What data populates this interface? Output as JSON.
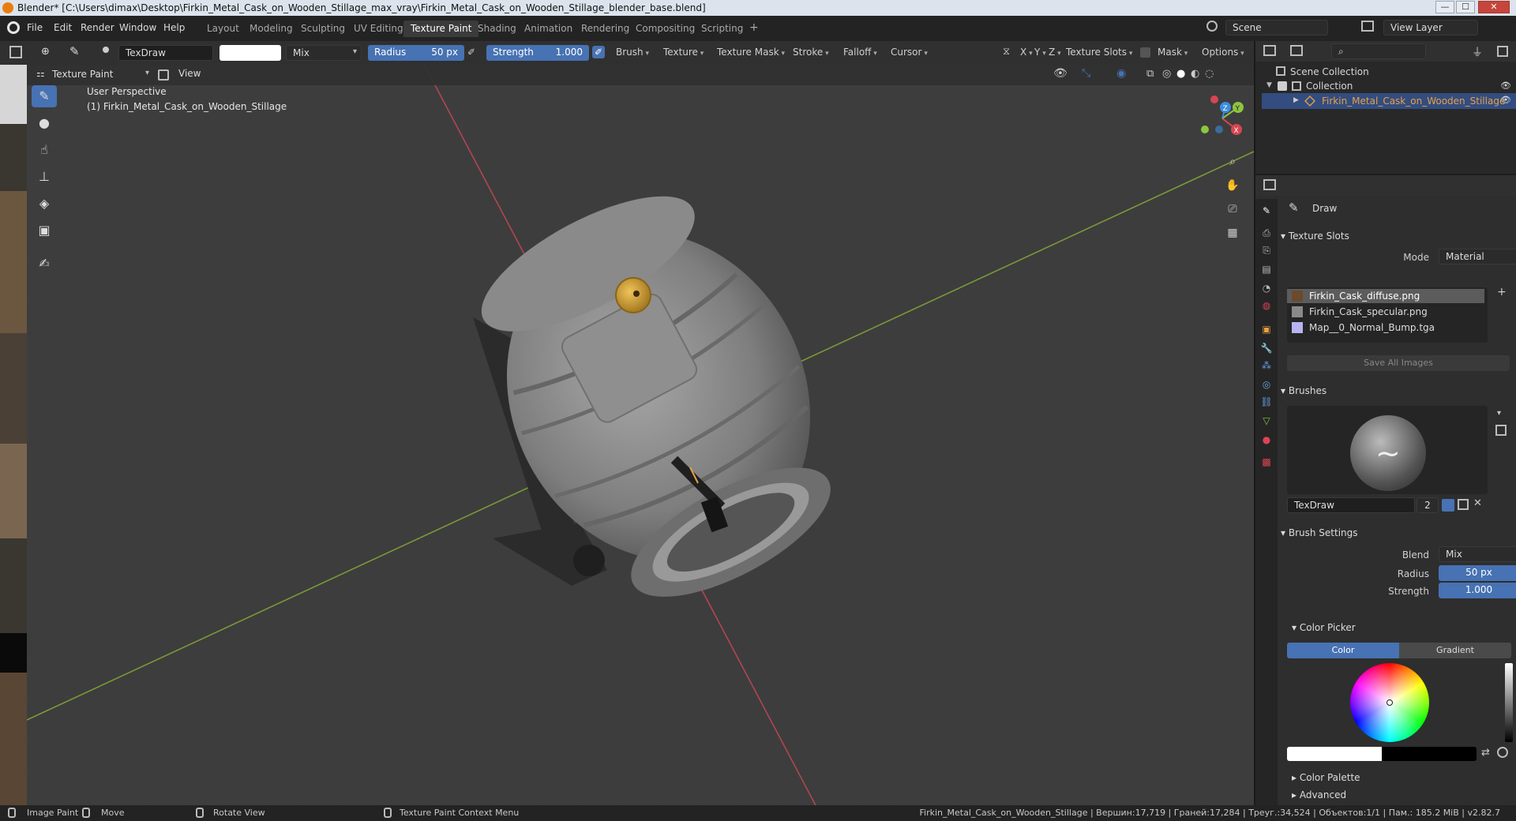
{
  "window": {
    "title": "Blender* [C:\\Users\\dimax\\Desktop\\Firkin_Metal_Cask_on_Wooden_Stillage_max_vray\\Firkin_Metal_Cask_on_Wooden_Stillage_blender_base.blend]",
    "minimize": "—",
    "maximize": "☐",
    "close": "✕"
  },
  "menu": [
    "File",
    "Edit",
    "Render",
    "Window",
    "Help"
  ],
  "workspaces": [
    "Layout",
    "Modeling",
    "Sculpting",
    "UV Editing",
    "Texture Paint",
    "Shading",
    "Animation",
    "Rendering",
    "Compositing",
    "Scripting"
  ],
  "active_workspace": "Texture Paint",
  "add_workspace": "+",
  "scene": {
    "name": "Scene",
    "view_layer": "View Layer"
  },
  "toolbar": {
    "brush_name": "TexDraw",
    "blend": "Mix",
    "radius_label": "Radius",
    "radius_value": "50 px",
    "strength_label": "Strength",
    "strength_value": "1.000",
    "menus": [
      "Brush",
      "Texture",
      "Texture Mask",
      "Stroke",
      "Falloff",
      "Cursor"
    ],
    "axes": [
      "X",
      "Y",
      "Z"
    ],
    "texture_slots": "Texture Slots",
    "mask": "Mask",
    "options": "Options",
    "color_swatch": "#ffffff"
  },
  "viewport": {
    "mode": "Texture Paint",
    "view_menu": "View",
    "perspective": "User Perspective",
    "object_label": "(1) Firkin_Metal_Cask_on_Wooden_Stillage",
    "gizmo": {
      "x": "X",
      "y": "Y",
      "z": "Z"
    }
  },
  "outliner": {
    "scene_collection": "Scene Collection",
    "collection": "Collection",
    "object": "Firkin_Metal_Cask_on_Wooden_Stillage"
  },
  "properties": {
    "tool_name": "Draw",
    "texture_slots": {
      "title": "Texture Slots",
      "mode_label": "Mode",
      "mode_value": "Material",
      "slots": [
        {
          "name": "Firkin_Cask_diffuse.png",
          "color": "#6b4a2e"
        },
        {
          "name": "Firkin_Cask_specular.png",
          "color": "#8a8a8a"
        },
        {
          "name": "Map__0_Normal_Bump.tga",
          "color": "#b8b4f0"
        }
      ],
      "save_all": "Save All Images"
    },
    "brushes": {
      "title": "Brushes",
      "name": "TexDraw",
      "users": "2"
    },
    "brush_settings": {
      "title": "Brush Settings",
      "blend_label": "Blend",
      "blend_value": "Mix",
      "radius_label": "Radius",
      "radius_value": "50 px",
      "strength_label": "Strength",
      "strength_value": "1.000"
    },
    "color_picker": {
      "title": "Color Picker",
      "tab_color": "Color",
      "tab_gradient": "Gradient"
    },
    "color_palette": "Color Palette",
    "advanced": "Advanced"
  },
  "status": {
    "left": "Image Paint",
    "move": "Move",
    "rotate": "Rotate View",
    "context": "Texture Paint Context Menu",
    "stats": "Firkin_Metal_Cask_on_Wooden_Stillage | Вершин:17,719 | Граней:17,284 | Треуг.:34,524 | Объектов:1/1 | Пам.: 185.2 MiB | v2.82.7"
  },
  "colors": {
    "accent": "#4772b3",
    "x_axis": "#d94552",
    "y_axis": "#8cc63f",
    "z_axis": "#3b8ce0",
    "highlight": "#e8a045"
  }
}
